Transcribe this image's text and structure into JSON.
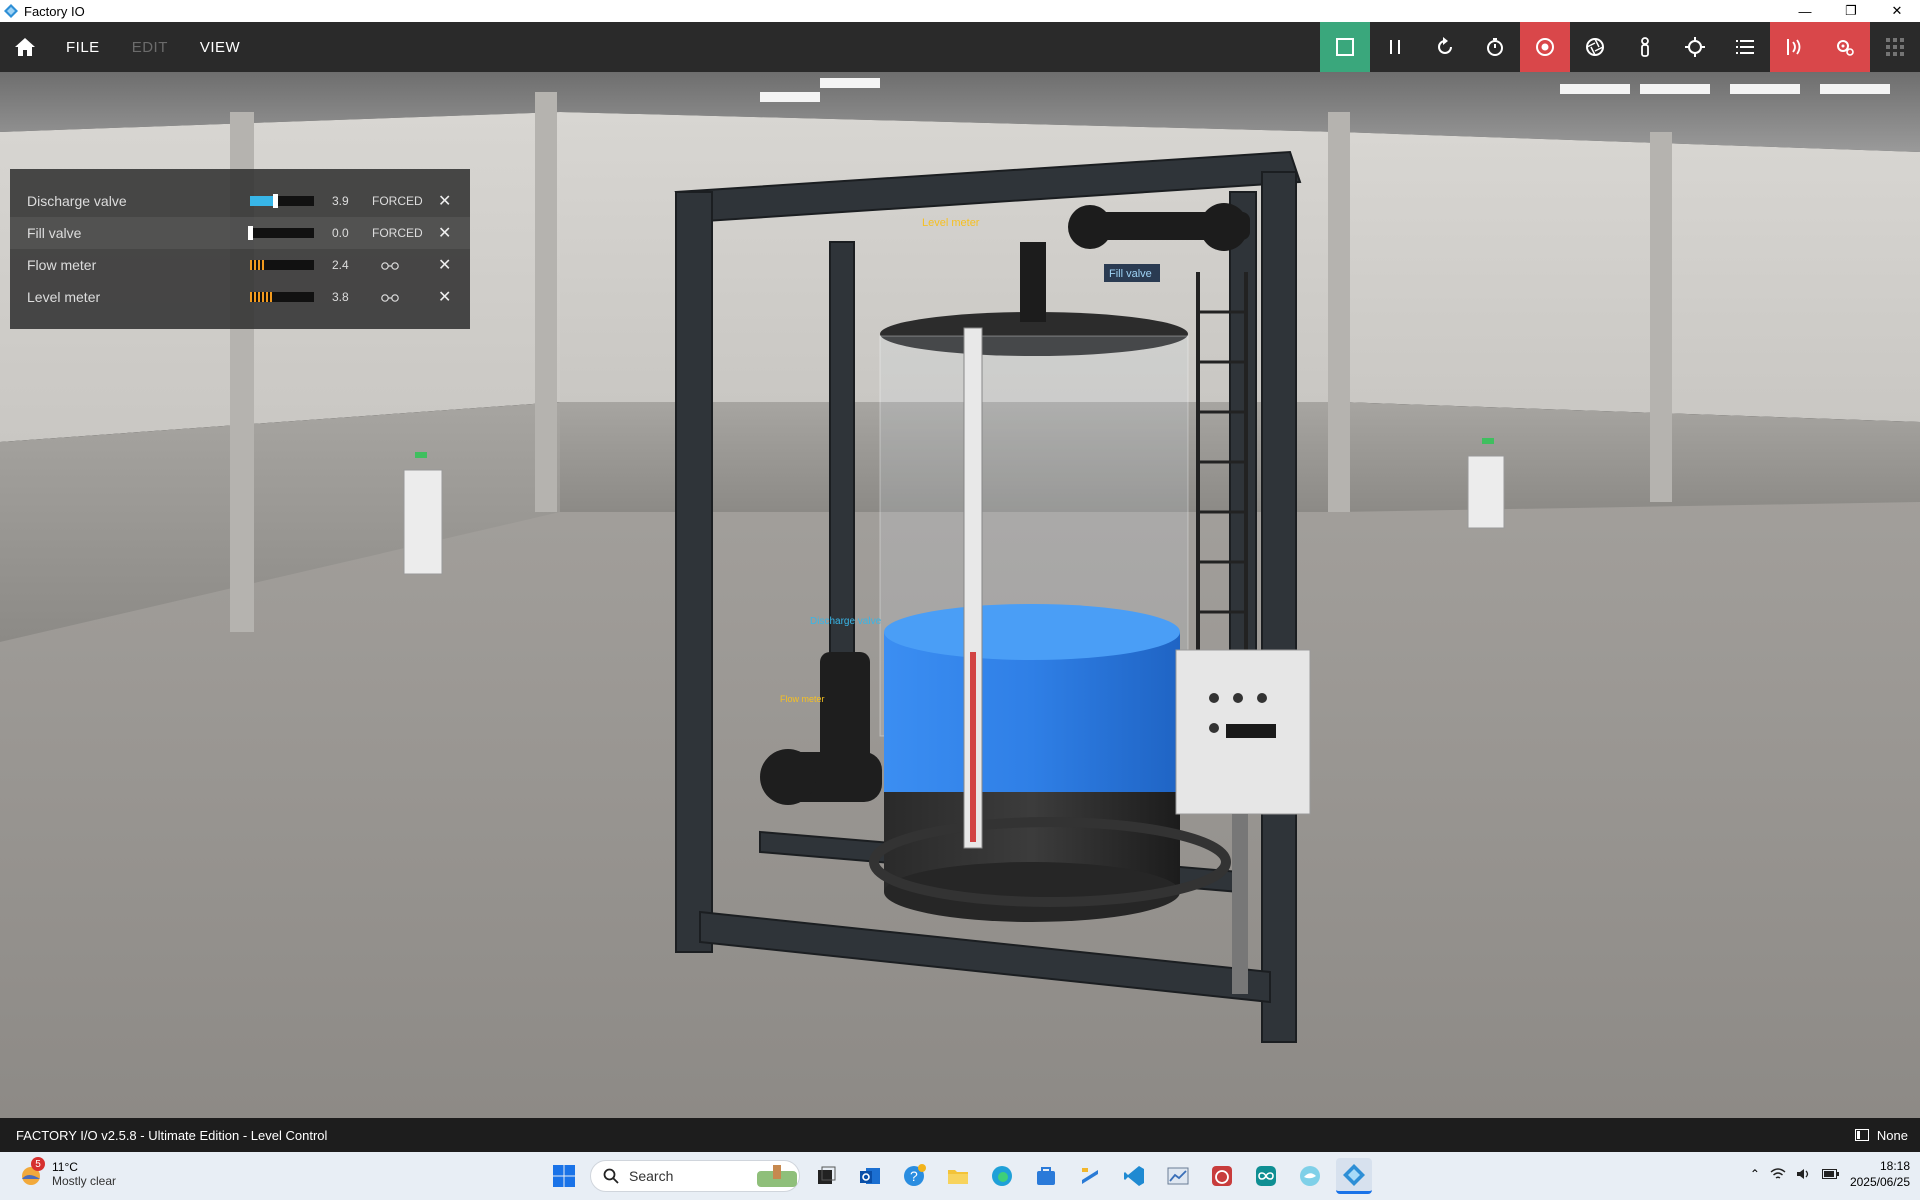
{
  "window": {
    "title": "Factory IO"
  },
  "menu": {
    "file": "FILE",
    "edit": "EDIT",
    "view": "VIEW"
  },
  "toolbar": {
    "items": [
      {
        "icon": "stop-square-icon",
        "state": "active"
      },
      {
        "icon": "pause-icon"
      },
      {
        "icon": "reset-icon"
      },
      {
        "icon": "timer-icon"
      },
      {
        "icon": "camera-orbit-icon",
        "state": "active"
      },
      {
        "icon": "aperture-icon"
      },
      {
        "icon": "first-person-icon"
      },
      {
        "icon": "crosshair-icon"
      },
      {
        "icon": "list-icon"
      },
      {
        "icon": "sensors-icon",
        "state": "active"
      },
      {
        "icon": "gears-icon",
        "state": "active"
      },
      {
        "icon": "grid-icon",
        "state": "disabled"
      }
    ]
  },
  "tags": [
    {
      "name": "Discharge valve",
      "value": "3.9",
      "mode": "FORCED",
      "mode_type": "text",
      "fill": 0.39,
      "color": "#38b6e8",
      "style": "slider"
    },
    {
      "name": "Fill valve",
      "value": "0.0",
      "mode": "FORCED",
      "mode_type": "text",
      "fill": 0.0,
      "color": "#ffffff",
      "style": "slider"
    },
    {
      "name": "Flow meter",
      "value": "2.4",
      "mode": "",
      "mode_type": "glasses-icon",
      "fill": 0.24,
      "color": "#f29a1e",
      "style": "ticks"
    },
    {
      "name": "Level meter",
      "value": "3.8",
      "mode": "",
      "mode_type": "glasses-icon",
      "fill": 0.38,
      "color": "#f29a1e",
      "style": "ticks"
    }
  ],
  "scene_labels": {
    "level_meter": "Level meter",
    "fill_valve": "Fill valve",
    "discharge_valve": "Discharge valve",
    "flow_meter": "Flow meter"
  },
  "status": {
    "text": "FACTORY I/O v2.5.8 - Ultimate Edition - Level Control",
    "right": "None"
  },
  "taskbar": {
    "weather_temp": "11°C",
    "weather_desc": "Mostly clear",
    "weather_badge": "5",
    "search_placeholder": "Search",
    "time": "18:18",
    "date": "2025/06/25"
  },
  "colors": {
    "accent_green": "#3aa77c",
    "accent_red": "#d9474a",
    "water": "#2f7fe6"
  }
}
